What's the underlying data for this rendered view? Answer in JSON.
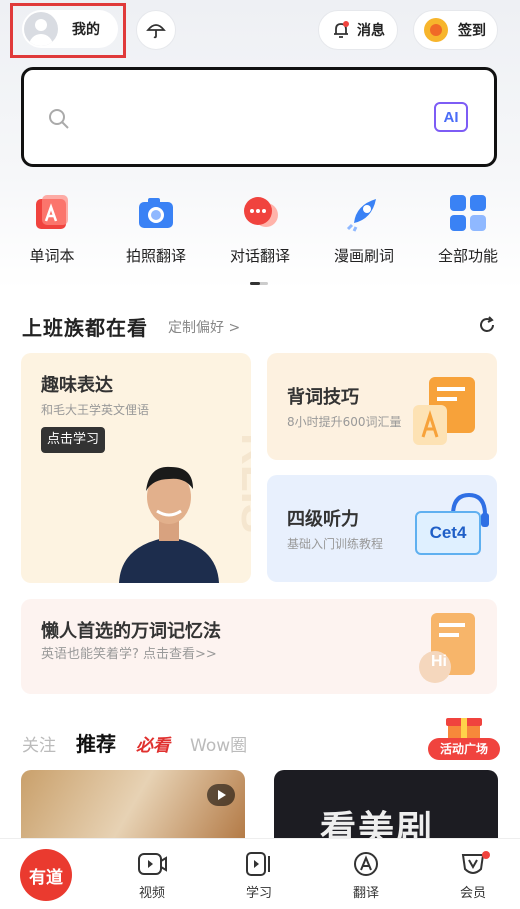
{
  "header": {
    "me_label": "我的",
    "message_label": "消息",
    "sign_in_label": "签到"
  },
  "search": {
    "ai_label": "AI"
  },
  "functions": [
    {
      "label": "单词本",
      "icon": "wordbook-icon",
      "color": "#f0433e"
    },
    {
      "label": "拍照翻译",
      "icon": "camera-icon",
      "color": "#3a82f5"
    },
    {
      "label": "对话翻译",
      "icon": "chat-icon",
      "color": "#f0433e"
    },
    {
      "label": "漫画刷词",
      "icon": "rocket-icon",
      "color": "#3a82f5"
    },
    {
      "label": "全部功能",
      "icon": "grid-icon",
      "color": "#3a82f5"
    }
  ],
  "section": {
    "title": "上班族都在看",
    "subtitle": "定制偏好 >"
  },
  "cards": {
    "fun": {
      "title": "趣味表达",
      "subtitle": "和毛大王学英文俚语",
      "button": "点击学习",
      "watermark": "RLIS"
    },
    "vocab": {
      "title": "背词技巧",
      "subtitle": "8小时提升600词汇量"
    },
    "cet": {
      "title": "四级听力",
      "subtitle": "基础入门训练教程",
      "badge": "Cet4"
    },
    "lazy": {
      "title": "懒人首选的万词记忆法",
      "subtitle": "英语也能笑着学? 点击查看>>",
      "badge": "Hi"
    }
  },
  "feed_tabs": [
    "关注",
    "推荐",
    "必看",
    "Wow圈"
  ],
  "activity_label": "活动广场",
  "thumb2_text": "看美剧",
  "nav": {
    "logo": "有道",
    "items": [
      {
        "label": "视频"
      },
      {
        "label": "学习"
      },
      {
        "label": "翻译"
      },
      {
        "label": "会员"
      }
    ]
  }
}
